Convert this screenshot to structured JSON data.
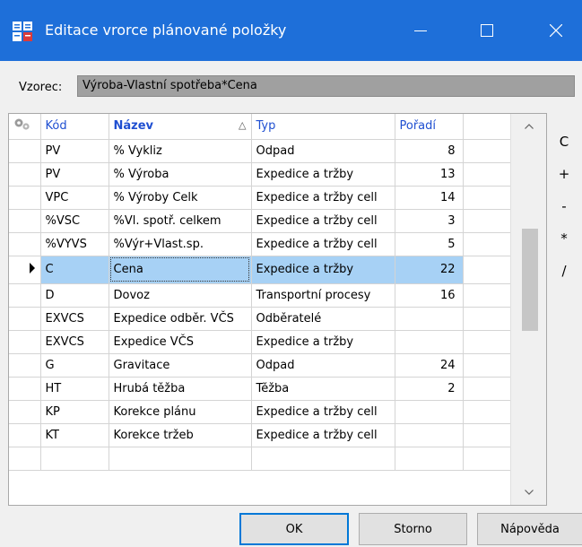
{
  "window": {
    "title": "Editace vrorce plánované položky",
    "controls": [
      "minimize-icon",
      "maximize-icon",
      "close-icon"
    ],
    "title_bar_color": "#1e6fd9"
  },
  "formula": {
    "label": "Vzorec:",
    "value": "Výroba-Vlastní spotřeba*Cena"
  },
  "grid": {
    "columns": {
      "code": "Kód",
      "name": "Název",
      "type": "Typ",
      "order": "Pořadí"
    },
    "sort_column": "name",
    "sort_direction": "ascending",
    "selected_row": 5,
    "selected_color": "#a7d1f5",
    "rows": [
      {
        "code": "PV",
        "name": "% Vykliz",
        "type": "Odpad",
        "order": "8"
      },
      {
        "code": "PV",
        "name": "% Výroba",
        "type": "Expedice a tržby",
        "order": "13"
      },
      {
        "code": "VPC",
        "name": "% Výroby Celk",
        "type": "Expedice a tržby cell",
        "order": "14"
      },
      {
        "code": "%VSC",
        "name": "%Vl. spotř. celkem",
        "type": "Expedice a tržby cell",
        "order": "3"
      },
      {
        "code": "%VYVS",
        "name": "%Výr+Vlast.sp.",
        "type": "Expedice a tržby cell",
        "order": "5"
      },
      {
        "code": "C",
        "name": "Cena",
        "type": "Expedice a tržby",
        "order": "22"
      },
      {
        "code": "D",
        "name": "Dovoz",
        "type": "Transportní procesy",
        "order": "16"
      },
      {
        "code": "EXVCS",
        "name": "Expedice odběr. VČS",
        "type": "Odběratelé",
        "order": ""
      },
      {
        "code": "EXVCS",
        "name": "Expedice VČS",
        "type": "Expedice a tržby",
        "order": ""
      },
      {
        "code": "G",
        "name": "Gravitace",
        "type": "Odpad",
        "order": "24"
      },
      {
        "code": "HT",
        "name": "Hrubá těžba",
        "type": "Těžba",
        "order": "2"
      },
      {
        "code": "KP",
        "name": "Korekce plánu",
        "type": "Expedice a tržby cell",
        "order": ""
      },
      {
        "code": "KT",
        "name": "Korekce tržeb",
        "type": "Expedice a tržby cell",
        "order": ""
      }
    ]
  },
  "operators": [
    "C",
    "+",
    "-",
    "*",
    "/"
  ],
  "buttons": {
    "ok": "OK",
    "cancel": "Storno",
    "help": "Nápověda"
  }
}
